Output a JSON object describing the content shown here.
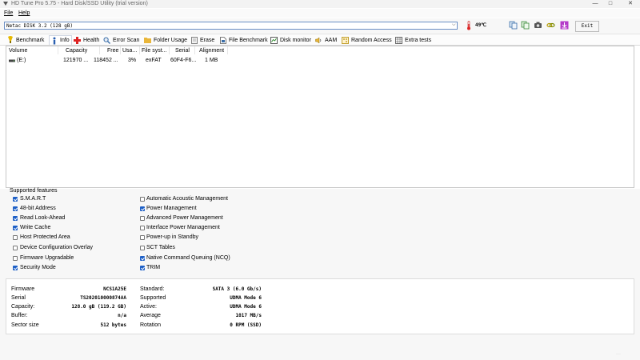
{
  "window": {
    "title": "HD Tune Pro 5.75 - Hard Disk/SSD Utility (trial version)",
    "minimize": "—",
    "maximize": "□",
    "close": "✕"
  },
  "menu": {
    "file": "File",
    "help": "Help"
  },
  "drivebar": {
    "drive_value": "Netac  DISK 3.2 (128 gB)",
    "temperature": "49℃",
    "exit_label": "Exit"
  },
  "tabs": [
    {
      "label": "Benchmark",
      "icon": "benchmark-icon"
    },
    {
      "label": "Info",
      "icon": "info-icon"
    },
    {
      "label": "Health",
      "icon": "health-icon"
    },
    {
      "label": "Error Scan",
      "icon": "error-scan-icon"
    },
    {
      "label": "Folder Usage",
      "icon": "folder-icon"
    },
    {
      "label": "Erase",
      "icon": "erase-icon"
    },
    {
      "label": "File Benchmark",
      "icon": "file-benchmark-icon"
    },
    {
      "label": "Disk monitor",
      "icon": "disk-monitor-icon"
    },
    {
      "label": "AAM",
      "icon": "speaker-icon"
    },
    {
      "label": "Random Access",
      "icon": "random-access-icon"
    },
    {
      "label": "Extra tests",
      "icon": "extra-tests-icon"
    }
  ],
  "active_tab": "Info",
  "volumes": {
    "headers": [
      "Volume",
      "Capacity",
      "Free",
      "Usa...",
      "File syst...",
      "Serial",
      "Alignment"
    ],
    "rows": [
      [
        "(E:)",
        "121970 ...",
        "118452 ...",
        "3%",
        "exFAT",
        "60F4-F6...",
        "1 MB"
      ]
    ]
  },
  "features": {
    "title": "Supported features",
    "left": [
      {
        "label": "S.M.A.R.T",
        "checked": true
      },
      {
        "label": "48-bit Address",
        "checked": true
      },
      {
        "label": "Read Look-Ahead",
        "checked": true
      },
      {
        "label": "Write Cache",
        "checked": true
      },
      {
        "label": "Host Protected Area",
        "checked": false
      },
      {
        "label": "Device Configuration Overlay",
        "checked": false
      },
      {
        "label": "Firmware Upgradable",
        "checked": false
      },
      {
        "label": "Security Mode",
        "checked": true
      }
    ],
    "right": [
      {
        "label": "Automatic Acoustic Management",
        "checked": false
      },
      {
        "label": "Power Management",
        "checked": true
      },
      {
        "label": "Advanced Power Management",
        "checked": false
      },
      {
        "label": "Interface Power Management",
        "checked": false
      },
      {
        "label": "Power-up in Standby",
        "checked": false
      },
      {
        "label": "SCT Tables",
        "checked": false
      },
      {
        "label": "Native Command Queuing (NCQ)",
        "checked": true
      },
      {
        "label": "TRIM",
        "checked": true
      }
    ]
  },
  "info": {
    "left": [
      {
        "label": "Firmware",
        "value": "NCS1A25E"
      },
      {
        "label": "Serial",
        "value": "TS202010000874AA"
      },
      {
        "label": "Capacity:",
        "value": "128.0 gB (119.2 GB)"
      },
      {
        "label": "Buffer:",
        "value": "n/a"
      },
      {
        "label": "Sector size",
        "value": "512 bytes"
      }
    ],
    "right": [
      {
        "label": "Standard:",
        "value": "SATA 3 (6.0 Gb/s)"
      },
      {
        "label": "Supported",
        "value": "UDMA Mode 6"
      },
      {
        "label": "Active:",
        "value": "UDMA Mode 6"
      },
      {
        "label": "Average",
        "value": "1017 MB/s"
      },
      {
        "label": "Rotation",
        "value": "0 RPM (SSD)"
      }
    ]
  },
  "colors": {
    "check_blue": "#1d5fc6",
    "select_border": "#6a8ec4"
  }
}
